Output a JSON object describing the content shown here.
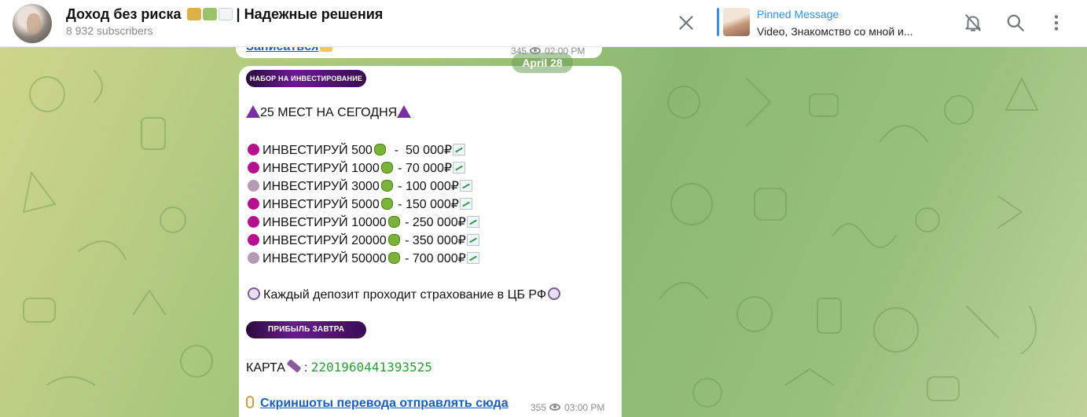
{
  "header": {
    "title": "Доход без риска",
    "title_suffix": " | Надежные решения",
    "subtitle": "8 932 subscribers",
    "title_emoji_icons": [
      "money-bag-lock-icon",
      "money-icon",
      "chart-up-icon"
    ],
    "pinned": {
      "label": "Pinned Message",
      "text": "Video, Знакомство со мной и..."
    },
    "icons": [
      "close-icon",
      "bell-off-icon",
      "search-icon",
      "more-vertical-icon"
    ],
    "accent_color": "#3390ec"
  },
  "previous_message": {
    "link_text": "Записаться",
    "views": "345",
    "time": "02:00 PM"
  },
  "date_pill": "April 28",
  "message": {
    "banner_top": "НАБОР НА ИНВЕСТИРОВАНИЕ",
    "headline": "25 МЕСТ НА СЕГОДНЯ",
    "items": [
      {
        "label": "ИНВЕСТИРУЙ 500",
        "sep": "  -  ",
        "amount": "50 000₽",
        "dot": "m"
      },
      {
        "label": "ИНВЕСТИРУЙ 1000",
        "sep": " - ",
        "amount": "70 000₽",
        "dot": "m"
      },
      {
        "label": "ИНВЕСТИРУЙ 3000",
        "sep": " - ",
        "amount": "100 000₽",
        "dot": "l"
      },
      {
        "label": "ИНВЕСТИРУЙ 5000",
        "sep": " - ",
        "amount": "150 000₽",
        "dot": "m"
      },
      {
        "label": "ИНВЕСТИРУЙ 10000",
        "sep": " - ",
        "amount": "250 000₽",
        "dot": "m"
      },
      {
        "label": "ИНВЕСТИРУЙ 20000",
        "sep": " - ",
        "amount": "350 000₽",
        "dot": "m"
      },
      {
        "label": "ИНВЕСТИРУЙ 50000",
        "sep": " - ",
        "amount": "700 000₽",
        "dot": "l"
      }
    ],
    "insurance": "Каждый депозит проходит страхование в ЦБ РФ",
    "banner_bottom": "ПРИБЫЛЬ ЗАВТРА",
    "card_label": "КАРТА",
    "card_number": "2201960441393525",
    "screenshot_link": "Скриншоты перевода отправлять сюда",
    "views": "355",
    "time": "03:00 PM"
  }
}
